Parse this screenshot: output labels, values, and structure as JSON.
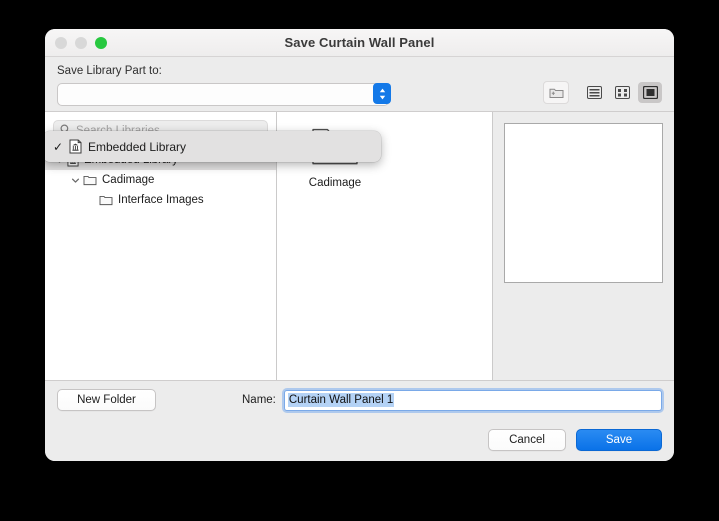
{
  "window": {
    "title": "Save Curtain Wall Panel",
    "traffic_lights": [
      {
        "name": "close",
        "color": "#d8d8d8"
      },
      {
        "name": "minimize",
        "color": "#d8d8d8"
      },
      {
        "name": "zoom",
        "color": "#28c840"
      }
    ]
  },
  "toolbar": {
    "save_to_label": "Save Library Part to:",
    "selected_destination": "Embedded Library",
    "view_buttons": [
      {
        "icon": "new-folder-icon",
        "label": ""
      },
      {
        "icon": "list-view-icon",
        "label": ""
      },
      {
        "icon": "icon-view-icon",
        "label": ""
      },
      {
        "icon": "column-view-icon",
        "label": ""
      }
    ],
    "active_view": "column-view-icon"
  },
  "popup_menu": {
    "items": [
      {
        "label": "Embedded Library",
        "checked": true,
        "icon": "library-document-icon"
      }
    ]
  },
  "sidebar": {
    "search": {
      "placeholder": "Search Libraries",
      "value": "",
      "icon": "search-icon"
    },
    "tree": [
      {
        "label": "Embedded Library",
        "icon": "library-document-icon",
        "depth": 0,
        "expanded": true,
        "selected": true
      },
      {
        "label": "Cadimage",
        "icon": "folder-icon",
        "depth": 1,
        "expanded": true,
        "selected": false
      },
      {
        "label": "Interface Images",
        "icon": "folder-icon",
        "depth": 2,
        "expanded": null,
        "selected": false
      }
    ]
  },
  "file_column": {
    "items": [
      {
        "label": "Cadimage",
        "icon": "folder-icon"
      }
    ]
  },
  "preview": {
    "empty": true
  },
  "footer": {
    "new_folder_label": "New Folder",
    "name_label": "Name:",
    "name_value": "Curtain Wall Panel 1",
    "name_placeholder": "",
    "cancel_label": "Cancel",
    "save_label": "Save"
  },
  "colors": {
    "accent_blue": "#1479e8",
    "selection_blue": "#b4d2f5",
    "window_bg": "#ececec",
    "green_light": "#28c840"
  }
}
